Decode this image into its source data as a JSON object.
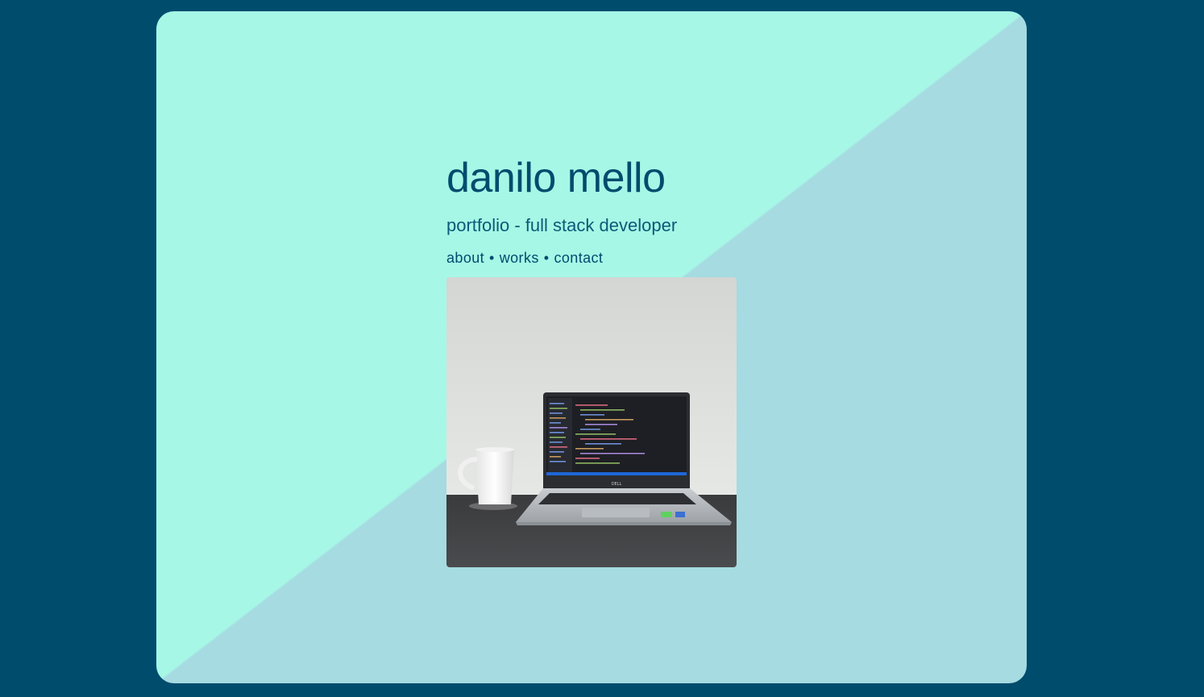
{
  "header": {
    "title": "danilo mello",
    "subtitle": "portfolio - full stack developer"
  },
  "nav": {
    "items": [
      {
        "label": "about"
      },
      {
        "label": "works"
      },
      {
        "label": "contact"
      }
    ],
    "separator": "•"
  },
  "photo": {
    "description_icon": "laptop-and-mug-photo",
    "laptop_brand": "DELL"
  },
  "colors": {
    "page_background": "#004c6d",
    "card_top_left": "#a7f7e7",
    "card_bottom_right": "#a5dbe1",
    "text": "#004c6d"
  }
}
